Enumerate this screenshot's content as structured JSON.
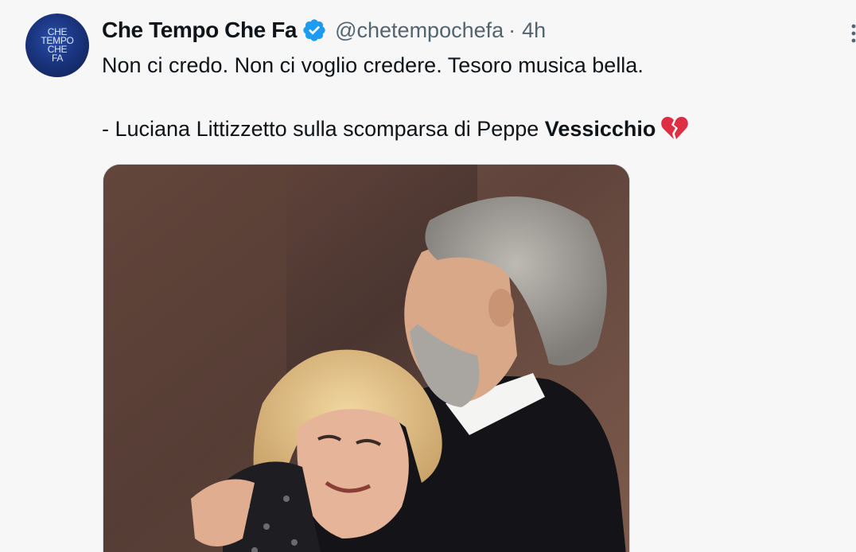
{
  "avatar": {
    "lines": [
      "CHE",
      "TEMPO",
      "CHE",
      "FA"
    ],
    "color": "#1a3580"
  },
  "author": {
    "display_name": "Che Tempo Che Fa",
    "handle": "@chetempochefa",
    "separator": "·",
    "time": "4h",
    "verified": true,
    "verified_color": "#1d9bf0"
  },
  "tweet": {
    "line1": "Non ci credo. Non ci voglio credere. Tesoro musica bella.",
    "line2_prefix": "- Luciana Littizzetto sulla scomparsa di Peppe ",
    "line2_bold": "Vessicchio",
    "emoji_icon": "broken-heart-icon"
  },
  "media": {
    "type": "photo",
    "icon": "photo-icon"
  },
  "icons": {
    "more": "more-icon"
  }
}
